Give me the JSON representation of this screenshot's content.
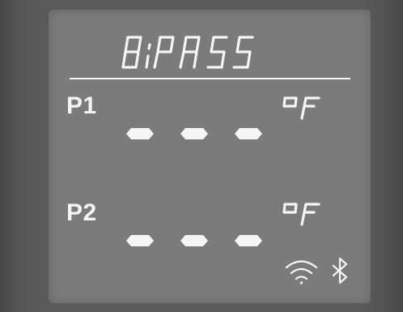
{
  "display": {
    "mode_text": "BYPASS",
    "probe1": {
      "label": "P1",
      "reading": "---",
      "unit": "oF"
    },
    "probe2": {
      "label": "P2",
      "reading": "---",
      "unit": "oF"
    },
    "wifi_icon": "wifi-icon",
    "bluetooth_icon": "bluetooth-icon"
  },
  "colors": {
    "segment_on": "#f5f5f5",
    "lcd_background": "#7b7b7b"
  }
}
